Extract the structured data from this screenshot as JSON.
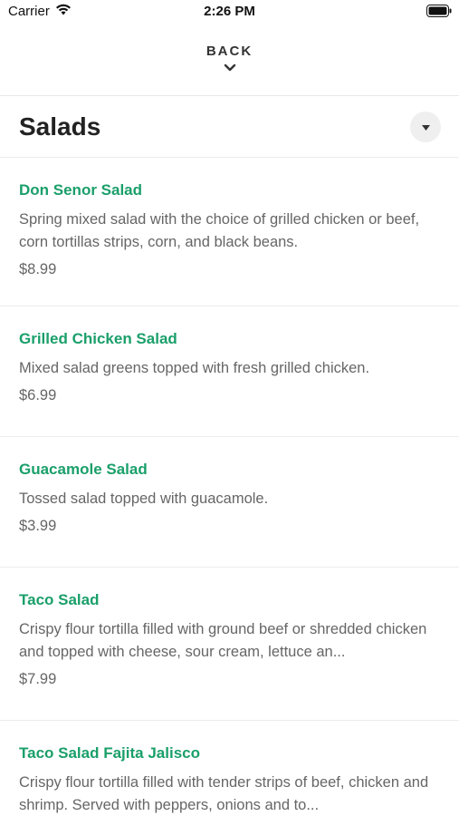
{
  "status_bar": {
    "carrier": "Carrier",
    "time": "2:26 PM"
  },
  "nav": {
    "back_label": "BACK"
  },
  "section": {
    "title": "Salads"
  },
  "colors": {
    "accent": "#1a9f6a",
    "text_secondary": "#666666"
  },
  "items": [
    {
      "name": "Don Senor Salad",
      "description": "Spring mixed salad with the choice of grilled chicken or beef, corn tortillas strips, corn, and black beans.",
      "price": "$8.99"
    },
    {
      "name": "Grilled Chicken Salad",
      "description": "Mixed salad greens topped with fresh grilled chicken.",
      "price": "$6.99"
    },
    {
      "name": "Guacamole Salad",
      "description": "Tossed salad topped with guacamole.",
      "price": "$3.99"
    },
    {
      "name": "Taco Salad",
      "description": "Crispy flour tortilla filled with ground beef or shredded chicken and topped with cheese, sour cream, lettuce an...",
      "price": "$7.99"
    },
    {
      "name": "Taco Salad Fajita Jalisco",
      "description": "Crispy flour tortilla filled with tender strips of beef, chicken and shrimp. Served with peppers, onions and to...",
      "price": ""
    }
  ]
}
